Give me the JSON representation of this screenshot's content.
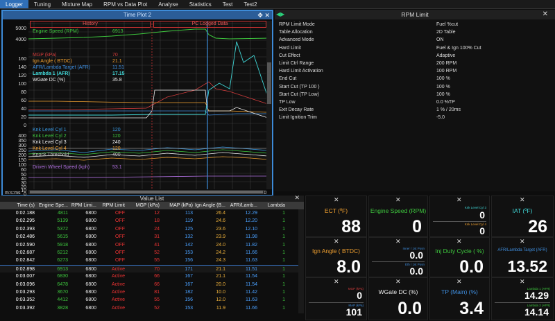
{
  "menu": [
    "Logger",
    "Tuning",
    "Mixture Map",
    "RPM vs Data Plot",
    "Analyse",
    "Statistics",
    "Test",
    "Test2"
  ],
  "timeplot": {
    "title": "Time Plot 2",
    "history_label": "History",
    "pc_label": "PC Logged Data",
    "y_ticks_top": [
      "5000",
      "4000",
      "160",
      "140",
      "120",
      "100",
      "80",
      "60",
      "40",
      "20",
      "0"
    ],
    "y_ticks_bottom": [
      "400",
      "350",
      "300",
      "250",
      "200",
      "150",
      "100",
      "60",
      "50",
      "40",
      "30",
      "20",
      "10",
      "0"
    ],
    "x_unit": "m:s:ms",
    "x_ticks": [
      "0:00.500",
      "0:01.000",
      "0:01.500",
      "0:02.000",
      "0:02.500",
      "0:03.000",
      "0:03.500"
    ],
    "legend": [
      {
        "name": "Engine Speed (RPM)",
        "value": "6913",
        "color": "#3ec83e"
      },
      {
        "name": "MGP (kPa)",
        "value": "70",
        "color": "#d23c3c"
      },
      {
        "name": "Ign Angle ( BTDC)",
        "value": "21.1",
        "color": "#f0a030"
      },
      {
        "name": "AFR/Lambda Target (AFR)",
        "value": "11.51",
        "color": "#3f8fe0"
      },
      {
        "name": "Lambda 1 (AFR)",
        "value": "17.15",
        "color": "#40d8d8"
      },
      {
        "name": "WGate DC (%)",
        "value": "35.8",
        "color": "#eeeeee"
      },
      {
        "name": "Knk Level Cyl 1",
        "value": "120",
        "color": "#3a9de8"
      },
      {
        "name": "Knk Level Cyl 2",
        "value": "120",
        "color": "#3ec83e"
      },
      {
        "name": "Knk Level Cyl 3",
        "value": "240",
        "color": "#f0f0f0"
      },
      {
        "name": "Knk Level Cyl 4",
        "value": "120",
        "color": "#f0a030"
      },
      {
        "name": "Knock Threshold",
        "value": "400",
        "color": "#bbbbbb"
      },
      {
        "name": "Driven Wheel Speed (kph)",
        "value": "53.1",
        "color": "#b070e0"
      }
    ]
  },
  "rpm_limit": {
    "title": "RPM Limit",
    "rows": [
      [
        "RPM Limit Mode",
        "Fuel %cut"
      ],
      [
        "Table Allocation",
        "2D Table"
      ],
      [
        "Advanced Mode",
        "ON"
      ],
      [
        "Hard Limit",
        "Fuel & Ign 100% Cut"
      ],
      [
        "Cut Effect",
        "Adaptive"
      ],
      [
        "Limit Ctrl Range",
        "200 RPM"
      ],
      [
        "Hard Limit Activation",
        "100 RPM"
      ],
      [
        "End Cut",
        "100 %"
      ],
      [
        "Start Cut (TP 100 )",
        "100 %"
      ],
      [
        "Start Cut (TP Low)",
        "100 %"
      ],
      [
        "TP Low",
        "0.0 %TP"
      ],
      [
        "Exit Decay Rate",
        "1 % / 20ms"
      ],
      [
        "Limit Ignition Trim",
        "-5.0"
      ]
    ]
  },
  "value_list": {
    "title": "Value List",
    "headers": [
      "Time (s)",
      "Engine Spe...",
      "RPM Limi...",
      "RPM Limit",
      "MGP (kPa)",
      "MAP (kPa)",
      "Ign Angle (B...",
      "AFR/Lamb...",
      "Lambda"
    ],
    "rows": [
      [
        "0:02.188",
        "4811",
        "6800",
        "OFF",
        "12",
        "113",
        "26.4",
        "12.29",
        "1"
      ],
      [
        "0:02.295",
        "5139",
        "6800",
        "OFF",
        "18",
        "119",
        "24.6",
        "12.20",
        "1"
      ],
      [
        "0:02.393",
        "5372",
        "6800",
        "OFF",
        "24",
        "125",
        "23.6",
        "12.10",
        "1"
      ],
      [
        "0:02.486",
        "5615",
        "6800",
        "OFF",
        "31",
        "132",
        "23.9",
        "11.98",
        "1"
      ],
      [
        "0:02.590",
        "5918",
        "6800",
        "OFF",
        "41",
        "142",
        "24.0",
        "11.82",
        "1"
      ],
      [
        "0:02.687",
        "6212",
        "6800",
        "OFF",
        "52",
        "153",
        "24.2",
        "11.66",
        "1"
      ],
      [
        "0:02.842",
        "6273",
        "6800",
        "OFF",
        "55",
        "156",
        "24.3",
        "11.63",
        "1"
      ],
      [
        "0:02.898",
        "6913",
        "6800",
        "Active",
        "70",
        "171",
        "21.1",
        "11.51",
        "1"
      ],
      [
        "0:03.007",
        "6830",
        "6800",
        "Active",
        "66",
        "167",
        "21.1",
        "11.54",
        "1"
      ],
      [
        "0:03.096",
        "6478",
        "6800",
        "Active",
        "66",
        "167",
        "20.0",
        "11.54",
        "1"
      ],
      [
        "0:03.293",
        "3670",
        "6800",
        "Active",
        "81",
        "182",
        "10.0",
        "11.42",
        "1"
      ],
      [
        "0:03.352",
        "4412",
        "6800",
        "Active",
        "55",
        "156",
        "12.0",
        "11.63",
        "1"
      ],
      [
        "0:03.392",
        "3828",
        "6800",
        "Active",
        "52",
        "153",
        "11.9",
        "11.66",
        "1"
      ]
    ],
    "current_row": 7
  },
  "gauges": {
    "ect": {
      "label": "ECT (ºF)",
      "value": "88"
    },
    "engine_speed": {
      "label": "Engine Speed (RPM)",
      "value": "0"
    },
    "knk1": {
      "label": "Knk Level Cyl 3",
      "value": "0"
    },
    "knk2": {
      "label": "Knk Level Cyl 4",
      "value": "0"
    },
    "iat": {
      "label": "IAT (ºF)",
      "value": "26"
    },
    "ign_angle": {
      "label": "Ign Angle ( BTDC)",
      "value": "8.0"
    },
    "inner1": {
      "label": "Inner / 1st Posn",
      "value": "0.0"
    },
    "inner2": {
      "label": "Eth / 1st Posn",
      "value": "0.0"
    },
    "inj_duty": {
      "label": "Inj Duty Cycle ( %)",
      "value": "0.0"
    },
    "afr_target": {
      "label": "AFR/Lambda Target (AFR)",
      "value": "13.52"
    },
    "mgp": {
      "label": "MGP (kPa)",
      "value": "0"
    },
    "map": {
      "label": "MAP (kPa)",
      "value": "101"
    },
    "wgate": {
      "label": "WGate DC (%)",
      "value": "0.0"
    },
    "tp_main": {
      "label": "TP (Main) (%)",
      "value": "3.4"
    },
    "lambda1": {
      "label": "Lambda 1 (AFR)",
      "value": "14.29"
    },
    "lambda2": {
      "label": "Lambda 2 (AFR)",
      "value": "14.14"
    }
  },
  "colors": {
    "accent": "#2f6fb8",
    "active": "#e33",
    "ok": "#3ec83e"
  }
}
